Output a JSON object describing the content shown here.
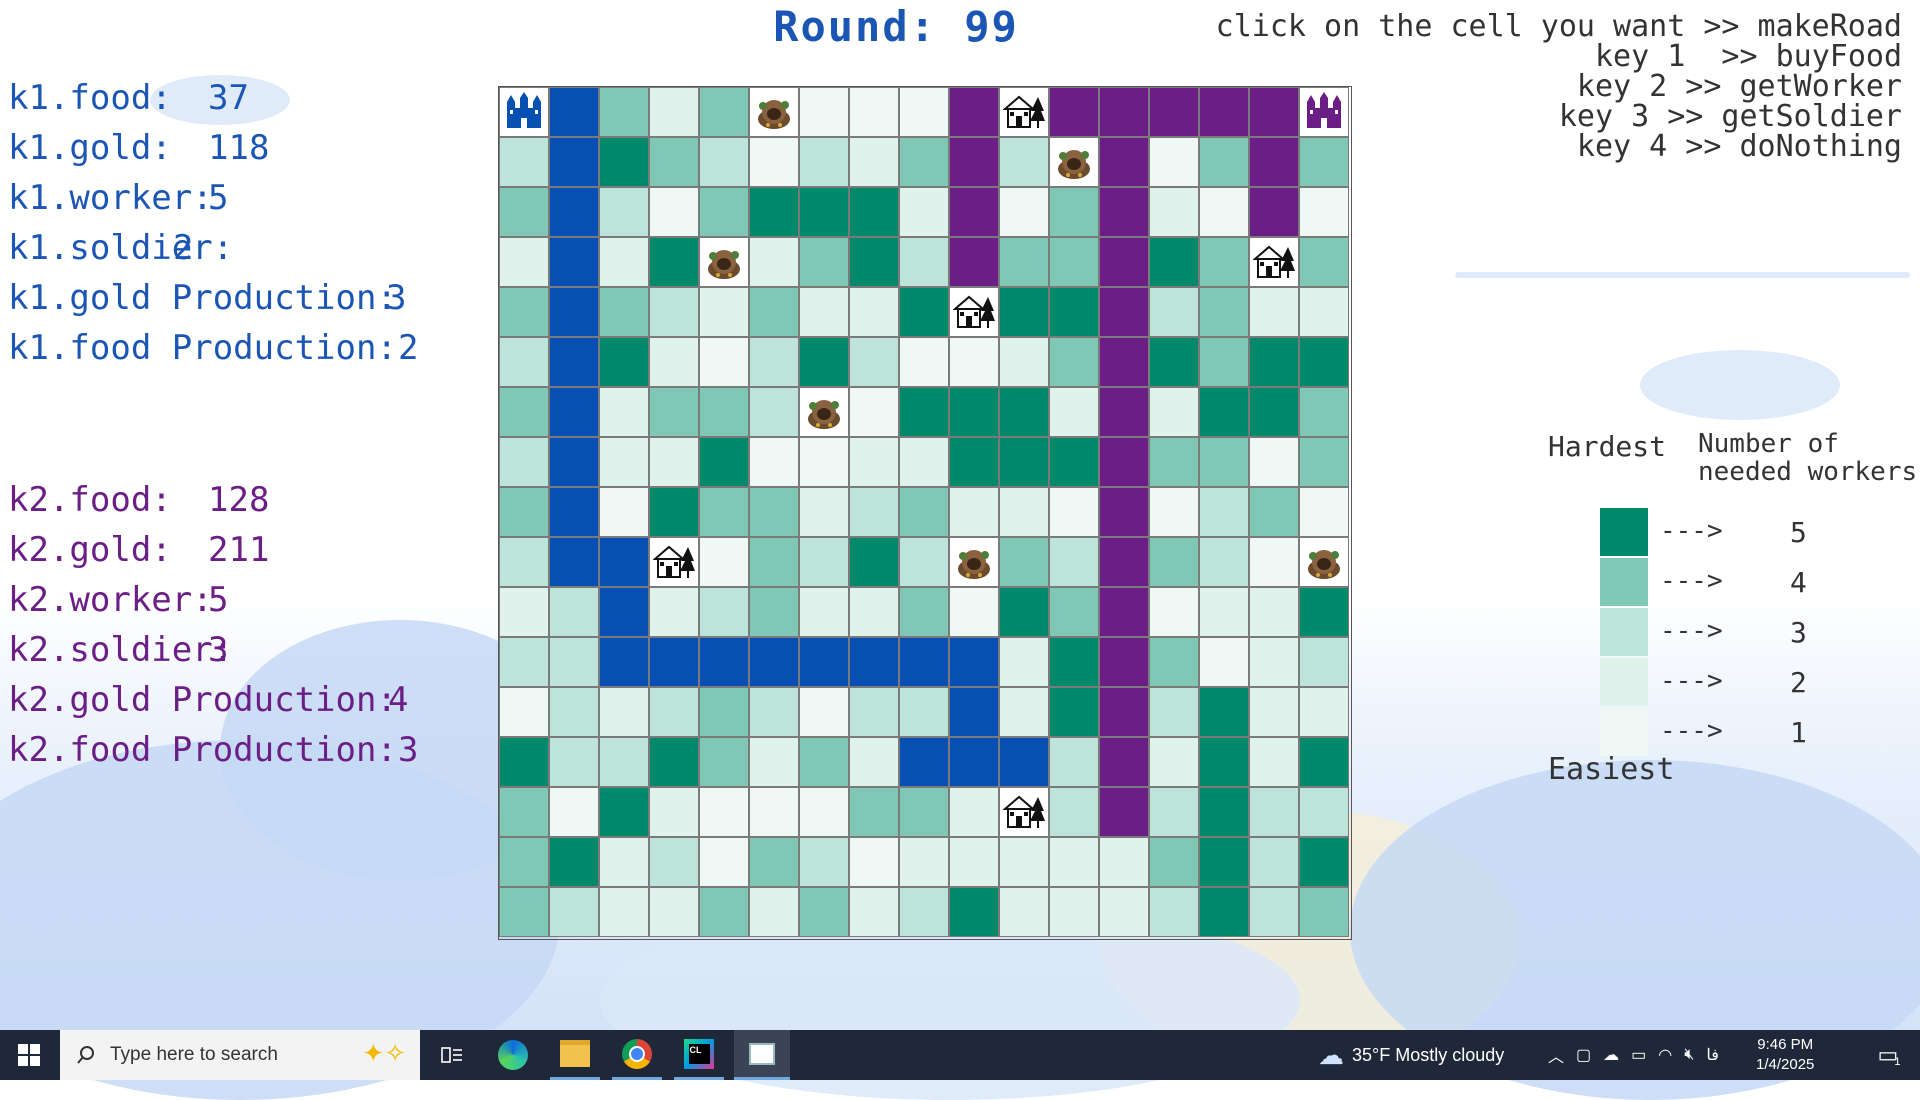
{
  "title": "Round: 99",
  "k1": [
    {
      "label": "k1.food:",
      "value": "37"
    },
    {
      "label": "k1.gold:",
      "value": "118"
    },
    {
      "label": "k1.worker:",
      "value": "5"
    },
    {
      "label": "k1.soldier:",
      "value": "2"
    },
    {
      "label": "k1.gold Production:",
      "value": "3"
    },
    {
      "label": "k1.food Production:",
      "value": "2"
    }
  ],
  "k2": [
    {
      "label": "k2.food:",
      "value": "128"
    },
    {
      "label": "k2.gold:",
      "value": "211"
    },
    {
      "label": "k2.worker:",
      "value": "5"
    },
    {
      "label": "k2.soldier:",
      "value": "3"
    },
    {
      "label": "k2.gold Production:",
      "value": "4"
    },
    {
      "label": "k2.food Production:",
      "value": "3"
    }
  ],
  "help": [
    "click on the cell you want >> makeRoad",
    "key 1  >> buyFood",
    "key 2 >> getWorker",
    "key 3 >> getSoldier",
    "key 4 >> doNothing"
  ],
  "legend": {
    "header_left": "Hardest",
    "header_right": "Number of needed workers",
    "footer": "Easiest",
    "arrow": "--->",
    "items": [
      {
        "color": "#00896a",
        "num": "5"
      },
      {
        "color": "#7fc8b5",
        "num": "4"
      },
      {
        "color": "#bde4da",
        "num": "3"
      },
      {
        "color": "#dff2ec",
        "num": "2"
      },
      {
        "color": "#eff8f5",
        "num": "1"
      }
    ]
  },
  "colors": {
    "k1_road": "#0650b4",
    "k2_road": "#6b1f86",
    "base": "#ffffff",
    "level": [
      "#eff8f5",
      "#dff2ec",
      "#bde4da",
      "#7fc8b5",
      "#00896a"
    ]
  },
  "grid_legend": {
    "1": "difficulty-1",
    "2": "difficulty-2",
    "3": "difficulty-3",
    "4": "difficulty-4",
    "5": "difficulty-5",
    "B": "k1-road",
    "P": "k2-road",
    "C": "k1-castle",
    "Q": "k2-castle",
    "H": "house",
    "G": "gold-mine"
  },
  "grid": [
    [
      "C",
      "B",
      "4",
      "2",
      "4",
      "G",
      "1",
      "1",
      "1",
      "P",
      "H",
      "P",
      "P",
      "P",
      "P",
      "P",
      "Q"
    ],
    [
      "3",
      "B",
      "5",
      "4",
      "3",
      "1",
      "3",
      "2",
      "4",
      "P",
      "3",
      "G",
      "P",
      "1",
      "4",
      "P",
      "4"
    ],
    [
      "4",
      "B",
      "3",
      "1",
      "4",
      "5",
      "5",
      "5",
      "2",
      "P",
      "1",
      "4",
      "P",
      "2",
      "1",
      "P",
      "1"
    ],
    [
      "2",
      "B",
      "2",
      "5",
      "G",
      "2",
      "4",
      "5",
      "3",
      "P",
      "4",
      "4",
      "P",
      "5",
      "4",
      "H",
      "4"
    ],
    [
      "4",
      "B",
      "4",
      "3",
      "2",
      "4",
      "2",
      "2",
      "5",
      "H",
      "5",
      "5",
      "P",
      "3",
      "4",
      "2",
      "2"
    ],
    [
      "3",
      "B",
      "5",
      "2",
      "1",
      "3",
      "5",
      "3",
      "1",
      "1",
      "2",
      "4",
      "P",
      "5",
      "4",
      "5",
      "5"
    ],
    [
      "4",
      "B",
      "2",
      "4",
      "4",
      "3",
      "G",
      "1",
      "5",
      "5",
      "5",
      "2",
      "P",
      "2",
      "5",
      "5",
      "4"
    ],
    [
      "3",
      "B",
      "2",
      "2",
      "5",
      "1",
      "1",
      "2",
      "2",
      "5",
      "5",
      "5",
      "P",
      "4",
      "4",
      "1",
      "4"
    ],
    [
      "4",
      "B",
      "1",
      "5",
      "4",
      "4",
      "2",
      "3",
      "4",
      "2",
      "2",
      "1",
      "P",
      "1",
      "3",
      "4",
      "1"
    ],
    [
      "3",
      "B",
      "B",
      "H",
      "1",
      "4",
      "3",
      "5",
      "3",
      "G",
      "4",
      "3",
      "P",
      "4",
      "3",
      "1",
      "G"
    ],
    [
      "2",
      "3",
      "B",
      "2",
      "3",
      "4",
      "2",
      "2",
      "4",
      "1",
      "5",
      "4",
      "P",
      "1",
      "2",
      "2",
      "5"
    ],
    [
      "3",
      "3",
      "B",
      "B",
      "B",
      "B",
      "B",
      "B",
      "B",
      "B",
      "2",
      "5",
      "P",
      "4",
      "1",
      "2",
      "3"
    ],
    [
      "1",
      "3",
      "2",
      "3",
      "4",
      "3",
      "1",
      "3",
      "3",
      "B",
      "2",
      "5",
      "P",
      "3",
      "5",
      "2",
      "2"
    ],
    [
      "5",
      "3",
      "3",
      "5",
      "4",
      "2",
      "4",
      "2",
      "B",
      "B",
      "B",
      "3",
      "P",
      "2",
      "5",
      "2",
      "5"
    ],
    [
      "4",
      "1",
      "5",
      "2",
      "1",
      "1",
      "1",
      "4",
      "4",
      "2",
      "H",
      "3",
      "P",
      "3",
      "5",
      "3",
      "3"
    ],
    [
      "4",
      "5",
      "2",
      "3",
      "1",
      "4",
      "3",
      "1",
      "2",
      "2",
      "2",
      "2",
      "2",
      "4",
      "5",
      "3",
      "5"
    ],
    [
      "4",
      "3",
      "2",
      "2",
      "4",
      "2",
      "4",
      "2",
      "3",
      "5",
      "2",
      "2",
      "2",
      "3",
      "5",
      "3",
      "4"
    ]
  ],
  "taskbar": {
    "search_placeholder": "Type here to search",
    "weather": "35°F  Mostly cloudy",
    "time": "9:46 PM",
    "date": "1/4/2025",
    "lang": "فا",
    "notif_count": "1"
  }
}
